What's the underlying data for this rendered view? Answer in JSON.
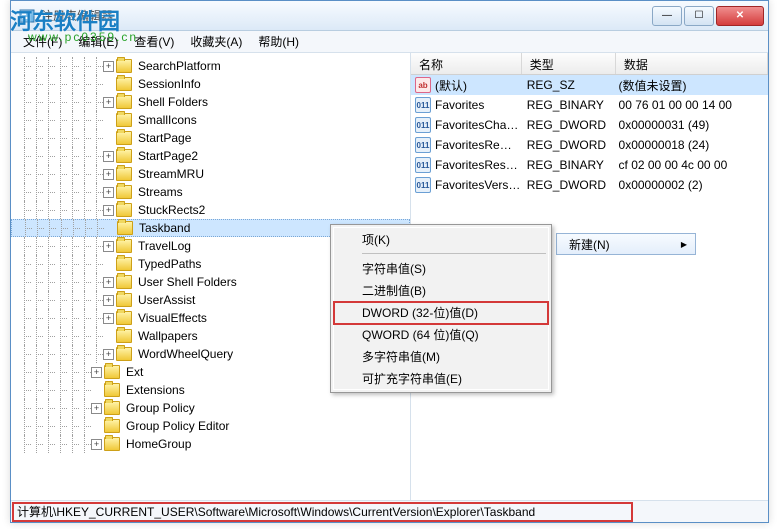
{
  "watermark": {
    "brand": "河东软件园",
    "url": "www.pc0359.cn"
  },
  "titlebar": {
    "title": "注册表编辑器"
  },
  "menubar": {
    "file": "文件(F)",
    "edit": "编辑(E)",
    "view": "查看(V)",
    "favorites": "收藏夹(A)",
    "help": "帮助(H)"
  },
  "tree": {
    "items": [
      {
        "indent": 7,
        "exp": "+",
        "label": "SearchPlatform"
      },
      {
        "indent": 7,
        "exp": "",
        "label": "SessionInfo"
      },
      {
        "indent": 7,
        "exp": "+",
        "label": "Shell Folders"
      },
      {
        "indent": 7,
        "exp": "",
        "label": "SmallIcons"
      },
      {
        "indent": 7,
        "exp": "",
        "label": "StartPage"
      },
      {
        "indent": 7,
        "exp": "+",
        "label": "StartPage2"
      },
      {
        "indent": 7,
        "exp": "+",
        "label": "StreamMRU"
      },
      {
        "indent": 7,
        "exp": "+",
        "label": "Streams"
      },
      {
        "indent": 7,
        "exp": "+",
        "label": "StuckRects2"
      },
      {
        "indent": 7,
        "exp": "",
        "label": "Taskband",
        "selected": true
      },
      {
        "indent": 7,
        "exp": "+",
        "label": "TravelLog"
      },
      {
        "indent": 7,
        "exp": "",
        "label": "TypedPaths"
      },
      {
        "indent": 7,
        "exp": "+",
        "label": "User Shell Folders"
      },
      {
        "indent": 7,
        "exp": "+",
        "label": "UserAssist"
      },
      {
        "indent": 7,
        "exp": "+",
        "label": "VisualEffects"
      },
      {
        "indent": 7,
        "exp": "",
        "label": "Wallpapers"
      },
      {
        "indent": 7,
        "exp": "+",
        "label": "WordWheelQuery"
      },
      {
        "indent": 6,
        "exp": "+",
        "label": "Ext"
      },
      {
        "indent": 6,
        "exp": "",
        "label": "Extensions"
      },
      {
        "indent": 6,
        "exp": "+",
        "label": "Group Policy"
      },
      {
        "indent": 6,
        "exp": "",
        "label": "Group Policy Editor"
      },
      {
        "indent": 6,
        "exp": "+",
        "label": "HomeGroup"
      }
    ]
  },
  "list": {
    "columns": {
      "name": "名称",
      "type": "类型",
      "data": "数据"
    },
    "colwidths": {
      "name": 130,
      "type": 110,
      "data": 180
    },
    "rows": [
      {
        "icon": "str",
        "name": "(默认)",
        "type": "REG_SZ",
        "data": "(数值未设置)",
        "selected": true
      },
      {
        "icon": "bin",
        "name": "Favorites",
        "type": "REG_BINARY",
        "data": "00 76 01 00 00 14 00"
      },
      {
        "icon": "bin",
        "name": "FavoritesChan...",
        "type": "REG_DWORD",
        "data": "0x00000031 (49)"
      },
      {
        "icon": "bin",
        "name": "FavoritesRemo...",
        "type": "REG_DWORD",
        "data": "0x00000018 (24)"
      },
      {
        "icon": "bin",
        "name": "FavoritesResol...",
        "type": "REG_BINARY",
        "data": "cf 02 00 00 4c 00 00"
      },
      {
        "icon": "bin",
        "name": "FavoritesVersion",
        "type": "REG_DWORD",
        "data": "0x00000002 (2)"
      }
    ]
  },
  "context": {
    "parent_label": "新建(N)",
    "items": [
      {
        "label": "项(K)"
      },
      {
        "sep": true
      },
      {
        "label": "字符串值(S)"
      },
      {
        "label": "二进制值(B)"
      },
      {
        "label": "DWORD (32-位)值(D)",
        "highlight": true
      },
      {
        "label": "QWORD (64 位)值(Q)"
      },
      {
        "label": "多字符串值(M)"
      },
      {
        "label": "可扩充字符串值(E)"
      }
    ]
  },
  "status": {
    "path": "计算机\\HKEY_CURRENT_USER\\Software\\Microsoft\\Windows\\CurrentVersion\\Explorer\\Taskband"
  }
}
